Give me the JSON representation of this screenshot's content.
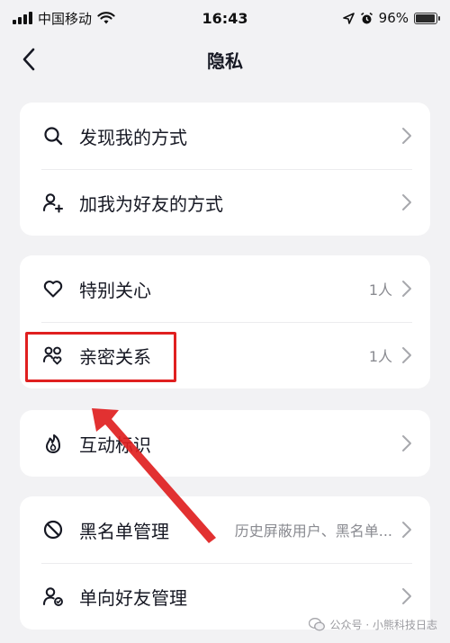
{
  "status_bar": {
    "carrier": "中国移动",
    "time": "16:43",
    "battery": "96%",
    "battery_level": 0.96
  },
  "nav": {
    "title": "隐私"
  },
  "groups": [
    {
      "items": [
        {
          "label": "发现我的方式",
          "value": "",
          "icon": "search-icon"
        },
        {
          "label": "加我为好友的方式",
          "value": "",
          "icon": "add-friend-icon"
        }
      ]
    },
    {
      "items": [
        {
          "label": "特别关心",
          "value": "1人",
          "icon": "heart-icon"
        },
        {
          "label": "亲密关系",
          "value": "1人",
          "icon": "intimate-relation-icon"
        }
      ]
    },
    {
      "items": [
        {
          "label": "互动标识",
          "value": "",
          "icon": "flame-icon"
        }
      ]
    },
    {
      "items": [
        {
          "label": "黑名单管理",
          "value": "历史屏蔽用户、黑名单...",
          "icon": "block-icon"
        },
        {
          "label": "单向好友管理",
          "value": "",
          "icon": "one-way-friend-icon"
        }
      ]
    }
  ],
  "annotation": {
    "highlight_color": "#e02020"
  },
  "watermark": {
    "text": "公众号 · 小熊科技日志"
  }
}
